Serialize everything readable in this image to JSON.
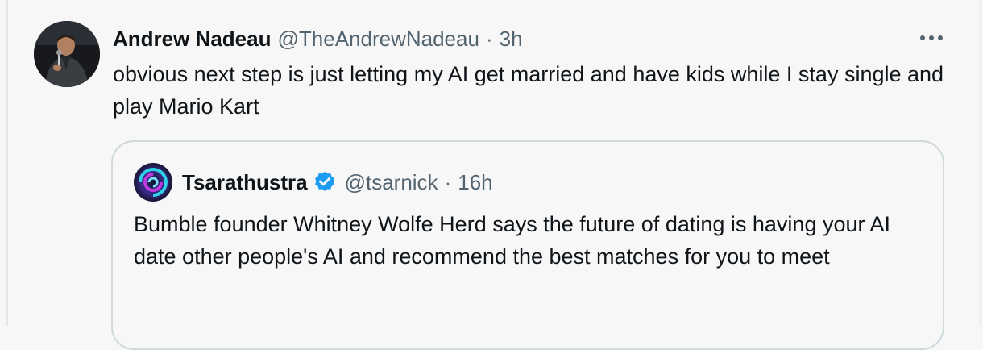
{
  "tweet": {
    "author_name": "Andrew Nadeau",
    "author_handle": "@TheAndrewNadeau",
    "separator": "·",
    "time": "3h",
    "more_icon": "more-horizontal-icon",
    "text": "obvious next step is just letting my AI get married and have kids while I stay single and play Mario Kart"
  },
  "quote": {
    "author_name": "Tsarathustra",
    "verified_icon": "verified-badge-icon",
    "author_handle": "@tsarnick",
    "separator": "·",
    "time": "16h",
    "text": "Bumble founder Whitney Wolfe Herd says the future of dating is having your AI date other people's AI and recommend the best matches for you to meet"
  },
  "colors": {
    "background": "#f7f7f7",
    "text": "#0f1419",
    "secondary": "#536471",
    "border": "#cfd9de",
    "verified": "#1d9bf0"
  }
}
